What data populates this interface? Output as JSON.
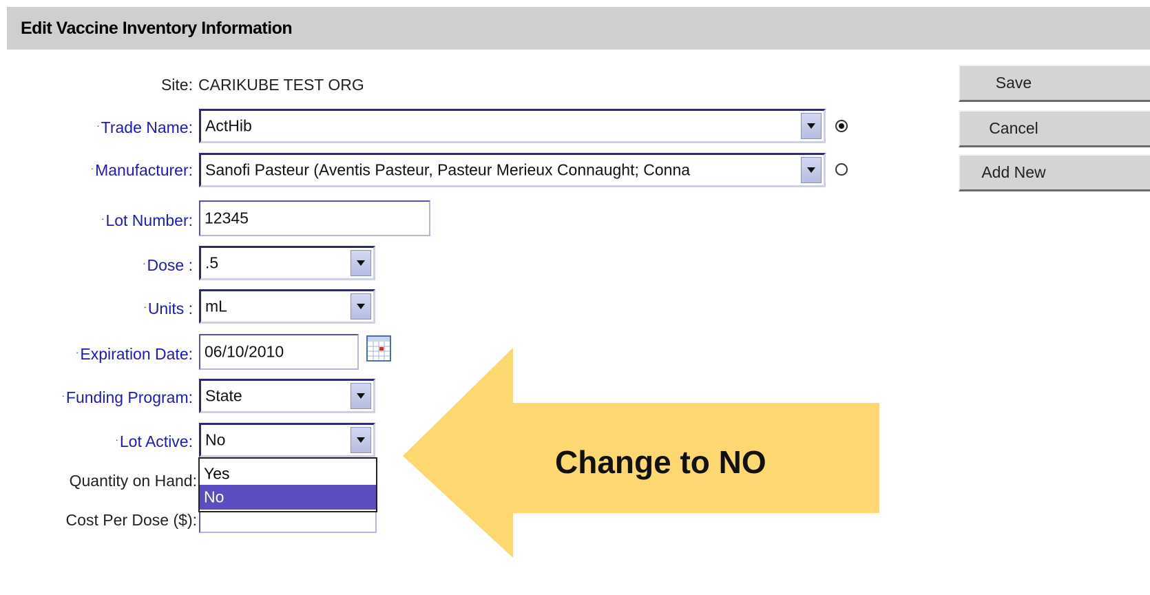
{
  "title": "Edit Vaccine Inventory Information",
  "site": {
    "label": "Site:",
    "value": "CARIKUBE TEST ORG"
  },
  "fields": {
    "trade_name": {
      "label": "Trade Name:",
      "value": "ActHib"
    },
    "manufacturer": {
      "label": "Manufacturer:",
      "value": "Sanofi Pasteur (Aventis Pasteur, Pasteur Merieux Connaught; Conna"
    },
    "lot_number": {
      "label": "Lot Number:",
      "value": "12345"
    },
    "dose": {
      "label": "Dose :",
      "value": ".5"
    },
    "units": {
      "label": "Units :",
      "value": "mL"
    },
    "expiration_date": {
      "label": "Expiration Date:",
      "value": "06/10/2010"
    },
    "funding_program": {
      "label": "Funding Program:",
      "value": "State"
    },
    "lot_active": {
      "label": "Lot Active:",
      "value": "No",
      "options": [
        "Yes",
        "No"
      ],
      "highlighted_option": "No"
    },
    "quantity_on_hand": {
      "label": "Quantity on Hand:"
    },
    "cost_per_dose": {
      "label": "Cost Per Dose ($):",
      "value": ""
    }
  },
  "search_mode": {
    "trade_name_selected": true,
    "manufacturer_selected": false
  },
  "buttons": {
    "save": "Save",
    "cancel": "Cancel",
    "add_new": "Add New"
  },
  "annotation": {
    "text": "Change to NO",
    "arrow_color": "#fdd870"
  },
  "colors": {
    "required_label": "#1a1ac0",
    "title_bar": "#cfcfcf",
    "selected_option": "#5b4cc0"
  }
}
